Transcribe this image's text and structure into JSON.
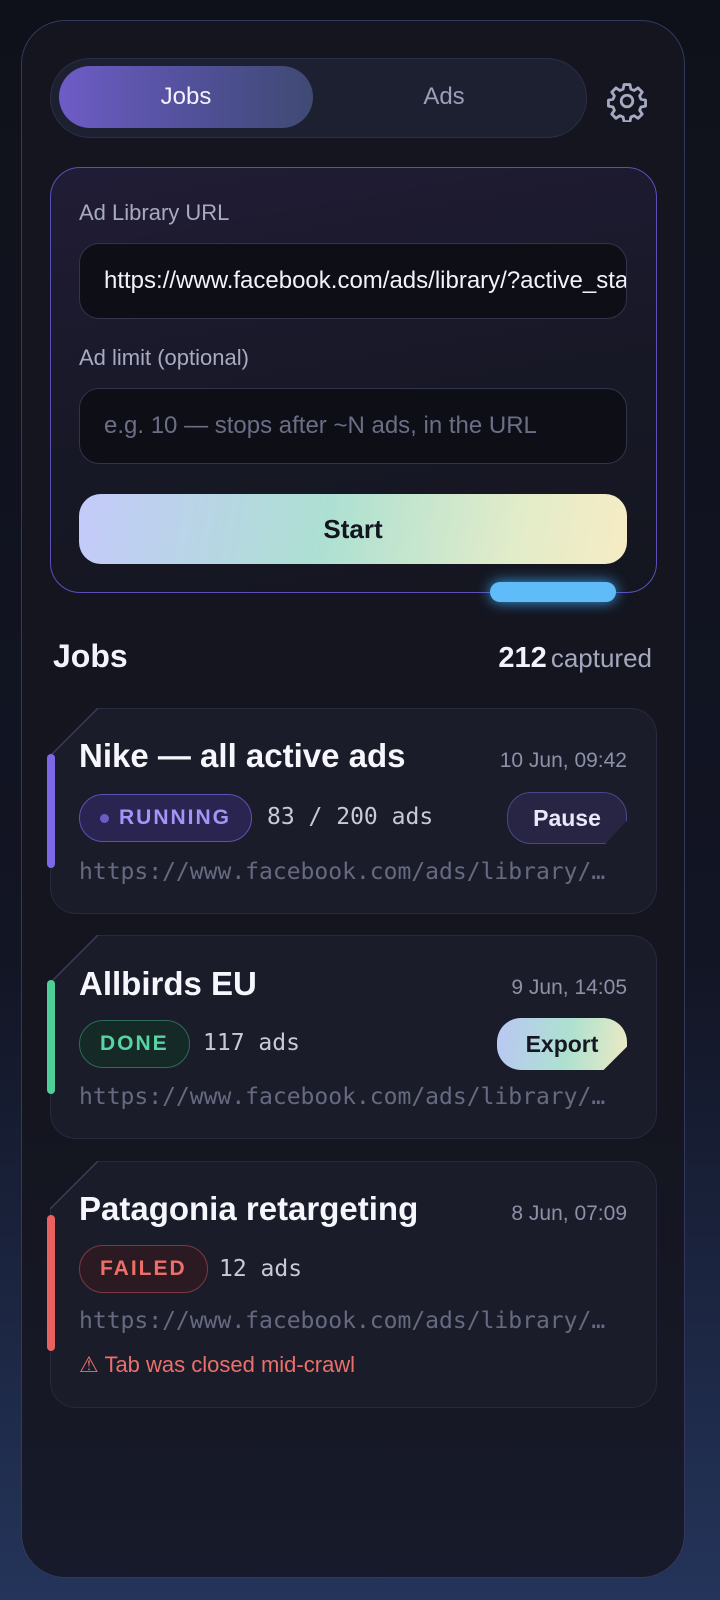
{
  "tabs": {
    "jobs": "Jobs",
    "ads": "Ads"
  },
  "form": {
    "url_label": "Ad Library URL",
    "url_value": "https://www.facebook.com/ads/library/?active_status=active&ad_type=all",
    "limit_label": "Ad limit (optional)",
    "limit_placeholder": "e.g. 10 — stops after ~N ads, in the URL",
    "start_label": "Start"
  },
  "jobs_section": {
    "title": "Jobs",
    "captured_count": "212",
    "captured_label": "captured"
  },
  "jobs": [
    {
      "title": "Nike — all active ads",
      "date": "10 Jun, 09:42",
      "status": "RUNNING",
      "count": "83 / 200 ads",
      "action": "Pause",
      "url": "https://www.facebook.com/ads/library/?active_status=active",
      "accent": "#7d68e6"
    },
    {
      "title": "Allbirds EU",
      "date": "9 Jun, 14:05",
      "status": "DONE",
      "count": "117 ads",
      "action": "Export",
      "url": "https://www.facebook.com/ads/library/?active_status=all",
      "accent": "#4fcf98"
    },
    {
      "title": "Patagonia retargeting",
      "date": "8 Jun, 07:09",
      "status": "FAILED",
      "count": "12 ads",
      "url": "https://www.facebook.com/ads/library/?active_status=active",
      "error": "⚠ Tab was closed mid-crawl",
      "accent": "#e8625f"
    }
  ]
}
